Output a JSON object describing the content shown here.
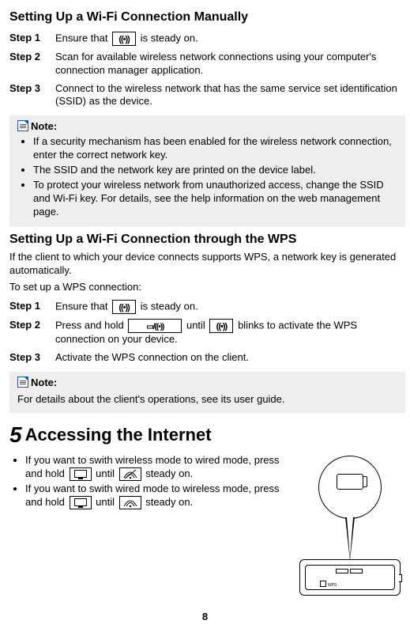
{
  "h1": "Setting Up a Wi-Fi Connection Manually",
  "steps_manual": {
    "s1_label": "Step 1",
    "s1_a": "Ensure that ",
    "s1_b": " is steady on.",
    "s2_label": "Step 2",
    "s2": "Scan for available wireless network connections using your computer's connection manager application.",
    "s3_label": "Step 3",
    "s3": "Connect to the wireless network that has the same service set identification (SSID) as the device."
  },
  "wifi_glyph": "((•))",
  "combo_glyph": "▭/((•))",
  "note1": {
    "head": "Note:",
    "b1": "If a security mechanism has been enabled for the wireless network connection, enter the correct network key.",
    "b2": "The SSID and the network key are printed on the device label.",
    "b3": "To protect your wireless network from unauthorized access, change the SSID and Wi-Fi key. For details, see the help information on the web management page."
  },
  "h2": "Setting Up a Wi-Fi Connection through the WPS",
  "wps_intro": "If the client to which your device connects supports WPS, a network key is generated automatically.",
  "wps_setup": "To set up a WPS connection:",
  "steps_wps": {
    "s1_label": "Step 1",
    "s1_a": "Ensure that ",
    "s1_b": " is steady on.",
    "s2_label": "Step 2",
    "s2_a": "Press and hold ",
    "s2_b": " until ",
    "s2_c": " blinks to activate the WPS connection on your device.",
    "s3_label": "Step 3",
    "s3": "Activate the WPS connection on the client."
  },
  "note2": {
    "head": "Note:",
    "body": "For details about the client's operations, see its user guide."
  },
  "sect5_num": "5",
  "sect5_title": "Accessing the Internet",
  "access": {
    "b1_a": "If you want to swith wireless mode to wired mode, press and hold ",
    "b1_b": " until ",
    "b1_c": " steady on.",
    "b2_a": "If you want to swith wired mode to wireless mode, press and hold ",
    "b2_b": " until ",
    "b2_c": " steady on."
  },
  "device_label": "WPS",
  "page_number": "8"
}
